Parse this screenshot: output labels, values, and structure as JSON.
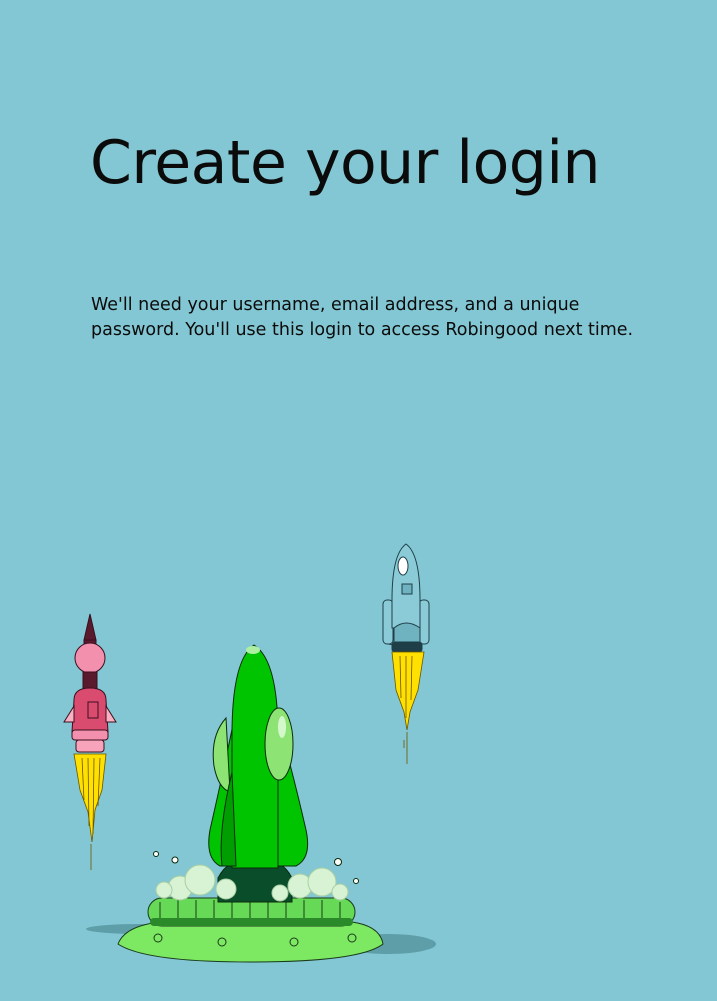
{
  "colors": {
    "background": "#82c7d3",
    "text": "#0b0b0b",
    "main_rocket": "#00c400",
    "launch_pad": "#7de862",
    "left_rocket": "#ef7fa0",
    "right_rocket": "#8bcbd8",
    "flame": "#ffe000"
  },
  "header": {
    "title": "Create your login"
  },
  "intro": {
    "description": "We'll need your username, email address, and a unique password. You'll use this login to access Robingood next time."
  },
  "illustration": {
    "icons": [
      "green-rocket-icon",
      "launch-pad-icon",
      "pink-rocket-icon",
      "blue-rocket-icon",
      "smoke-cloud-icon",
      "flame-icon"
    ]
  }
}
